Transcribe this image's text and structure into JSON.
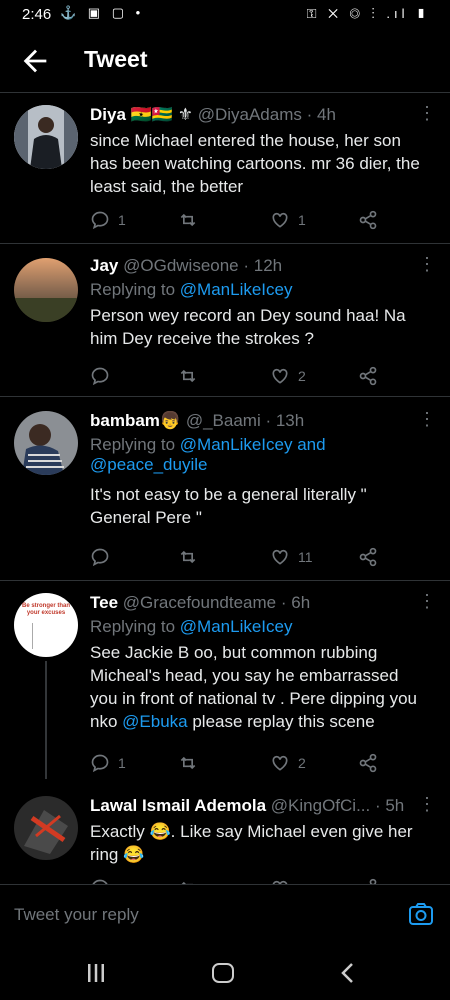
{
  "status": {
    "time": "2:46",
    "left_icons": "⚓ ▣ ▢ •",
    "right_icons": "⚿ ✕ ◎ ⁝ .ıl ▮"
  },
  "header": {
    "title": "Tweet"
  },
  "tweets": [
    {
      "name": "Diya",
      "badges": "🇬🇭🇹🇬 ⚜",
      "handle": "@DiyaAdams",
      "time": "· 4h",
      "text": "since Michael entered the house, her son has been watching cartoons. mr 36 dier, the least said, the better",
      "replies": "1",
      "retweets": "",
      "likes": "1"
    },
    {
      "name": "Jay",
      "handle": "@OGdwiseone",
      "time": "· 12h",
      "replying_prefix": "Replying to ",
      "replying_to": "@ManLikeIcey",
      "text": "Person wey record an Dey sound haa! Na him Dey receive the strokes ?",
      "replies": "",
      "retweets": "",
      "likes": "2"
    },
    {
      "name": "bambam",
      "badges": "👦",
      "handle": "@_Baami",
      "time": "· 13h",
      "replying_prefix": "Replying to ",
      "replying_to": "@ManLikeIcey and",
      "replying_to_2": "@peace_duyile",
      "text": "It's not easy to be a general literally \" General Pere \"",
      "replies": "",
      "retweets": "",
      "likes": "11"
    },
    {
      "name": "Tee",
      "handle": "@Gracefoundteame",
      "time": "· 6h",
      "replying_prefix": "Replying to ",
      "replying_to": "@ManLikeIcey",
      "text_before": "See Jackie B oo, but common rubbing Micheal's head, you say he embarrassed you in front of national tv . Pere dipping you nko ",
      "text_link": "@Ebuka",
      "text_after": " please replay this scene",
      "replies": "1",
      "retweets": "",
      "likes": "2",
      "avatar_text": "Be stronger than your excuses"
    },
    {
      "name": "Lawal Ismail Ademola",
      "handle": "@KingOfCi...",
      "time": "· 5h",
      "text": "Exactly 😂. Like say Michael even give her ring 😂"
    }
  ],
  "reply_bar": {
    "placeholder": "Tweet your reply"
  },
  "colors": {
    "background": "#000000",
    "accent": "#1d9bf0",
    "muted": "#71767b",
    "divider": "#2f3336"
  },
  "icons": [
    "back-arrow-icon",
    "more-icon",
    "reply-icon",
    "retweet-icon",
    "like-icon",
    "share-icon",
    "camera-icon",
    "recent-apps-icon",
    "home-icon",
    "nav-back-icon"
  ]
}
